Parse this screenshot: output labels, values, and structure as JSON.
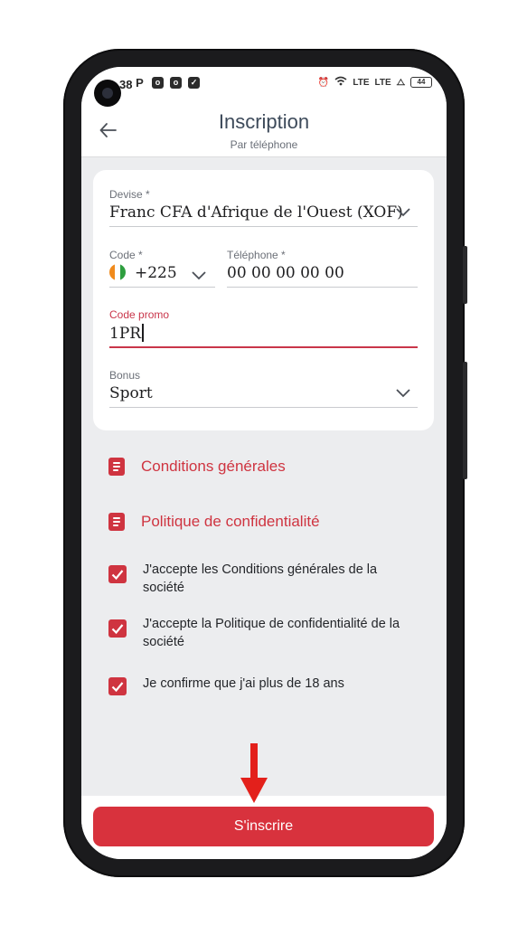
{
  "status_bar": {
    "time": "38",
    "signal_text": "LTE",
    "battery": "44"
  },
  "header": {
    "title": "Inscription",
    "subtitle": "Par téléphone"
  },
  "form": {
    "currency_label": "Devise *",
    "currency_value": "Franc CFA d'Afrique de l'Ouest (XOF)",
    "code_label": "Code *",
    "code_value": "+225",
    "phone_label": "Téléphone *",
    "phone_value": "00 00 00 00 00",
    "promo_label": "Code promo",
    "promo_value": "1PR",
    "bonus_label": "Bonus",
    "bonus_value": "Sport"
  },
  "links": {
    "terms": "Conditions générales",
    "privacy": "Politique de confidentialité"
  },
  "checkboxes": [
    {
      "label": "J'accepte les Conditions générales de la société",
      "checked": true
    },
    {
      "label": "J'accepte la Politique de confidentialité de la société",
      "checked": true
    },
    {
      "label": "Je confirme que j'ai plus de 18 ans",
      "checked": true
    }
  ],
  "submit_label": "S'inscrire",
  "colors": {
    "accent": "#d8323d",
    "title": "#3d4a5a",
    "background": "#ecedef"
  }
}
